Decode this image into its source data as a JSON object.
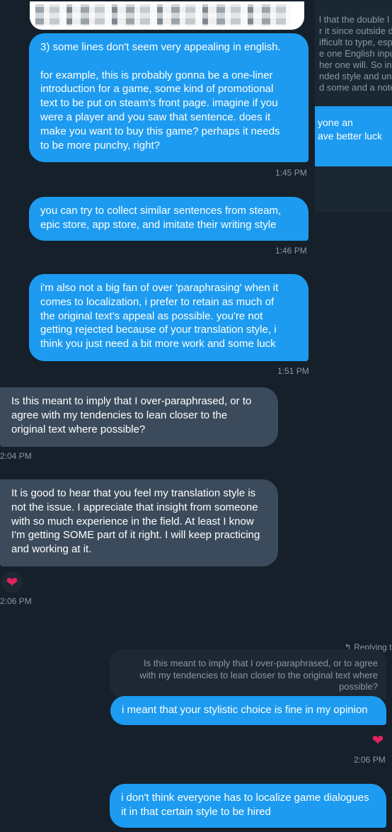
{
  "background_panel": {
    "lines": [
      "l that the double l",
      "r it since outside d",
      "ifficult to type, esp",
      "e one English inpu",
      "her one will. So in",
      "nded style and un",
      "d some and a note"
    ],
    "blue_lines": [
      "yone an",
      "ave better luck"
    ]
  },
  "messages": [
    {
      "text": "3) some lines don't seem very appealing in english.\n\nfor example, this is probably gonna be a one-liner\nintroduction for a game, some kind of promotional\ntext to be put on steam's front page. imagine if you\nwere a player and you saw that sentence. does it\nmake you want to buy this game? perhaps it needs\nto be more punchy, right?",
      "time": "1:45 PM"
    },
    {
      "text": "you can try to collect similar sentences from steam,\nepic store, app store, and imitate their writing style",
      "time": "1:46 PM"
    },
    {
      "text": "i'm also not a big fan of over 'paraphrasing' when it\ncomes to localization, i prefer to retain as much of\nthe original text's appeal as possible. you're not\ngetting rejected because of your translation style, i\nthink you just need a bit more work and some luck",
      "time": "1:51 PM"
    },
    {
      "text": "Is this meant to imply that I over-paraphrased, or to\nagree with my tendencies to lean closer to the\noriginal text where possible?",
      "time": "2:04 PM"
    },
    {
      "text": "It is good to hear that you feel my translation style is\nnot the issue. I appreciate that insight from someone\nwith so much experience in the field. At least I know\nI'm getting SOME part of it right. I will keep practicing\nand working at it.",
      "time": "2:06 PM"
    },
    {
      "text": "i meant that your stylistic choice is fine in my opinion",
      "time": "2:06 PM"
    },
    {
      "text": "i don't think everyone has to localize game dialogues\nit in that certain style to be hired"
    }
  ],
  "reply": {
    "label": "Replying to",
    "quoted": "Is this meant to imply that I over-paraphrased, or to agree\nwith my tendencies to lean closer to the original text where\npossible?"
  },
  "reaction": {
    "emoji": "❤"
  },
  "colors": {
    "background": "#15202b",
    "outgoing": "#1d9bf0",
    "incoming": "#3b4b5c",
    "meta": "#8b98a5",
    "heart": "#e0245e"
  }
}
